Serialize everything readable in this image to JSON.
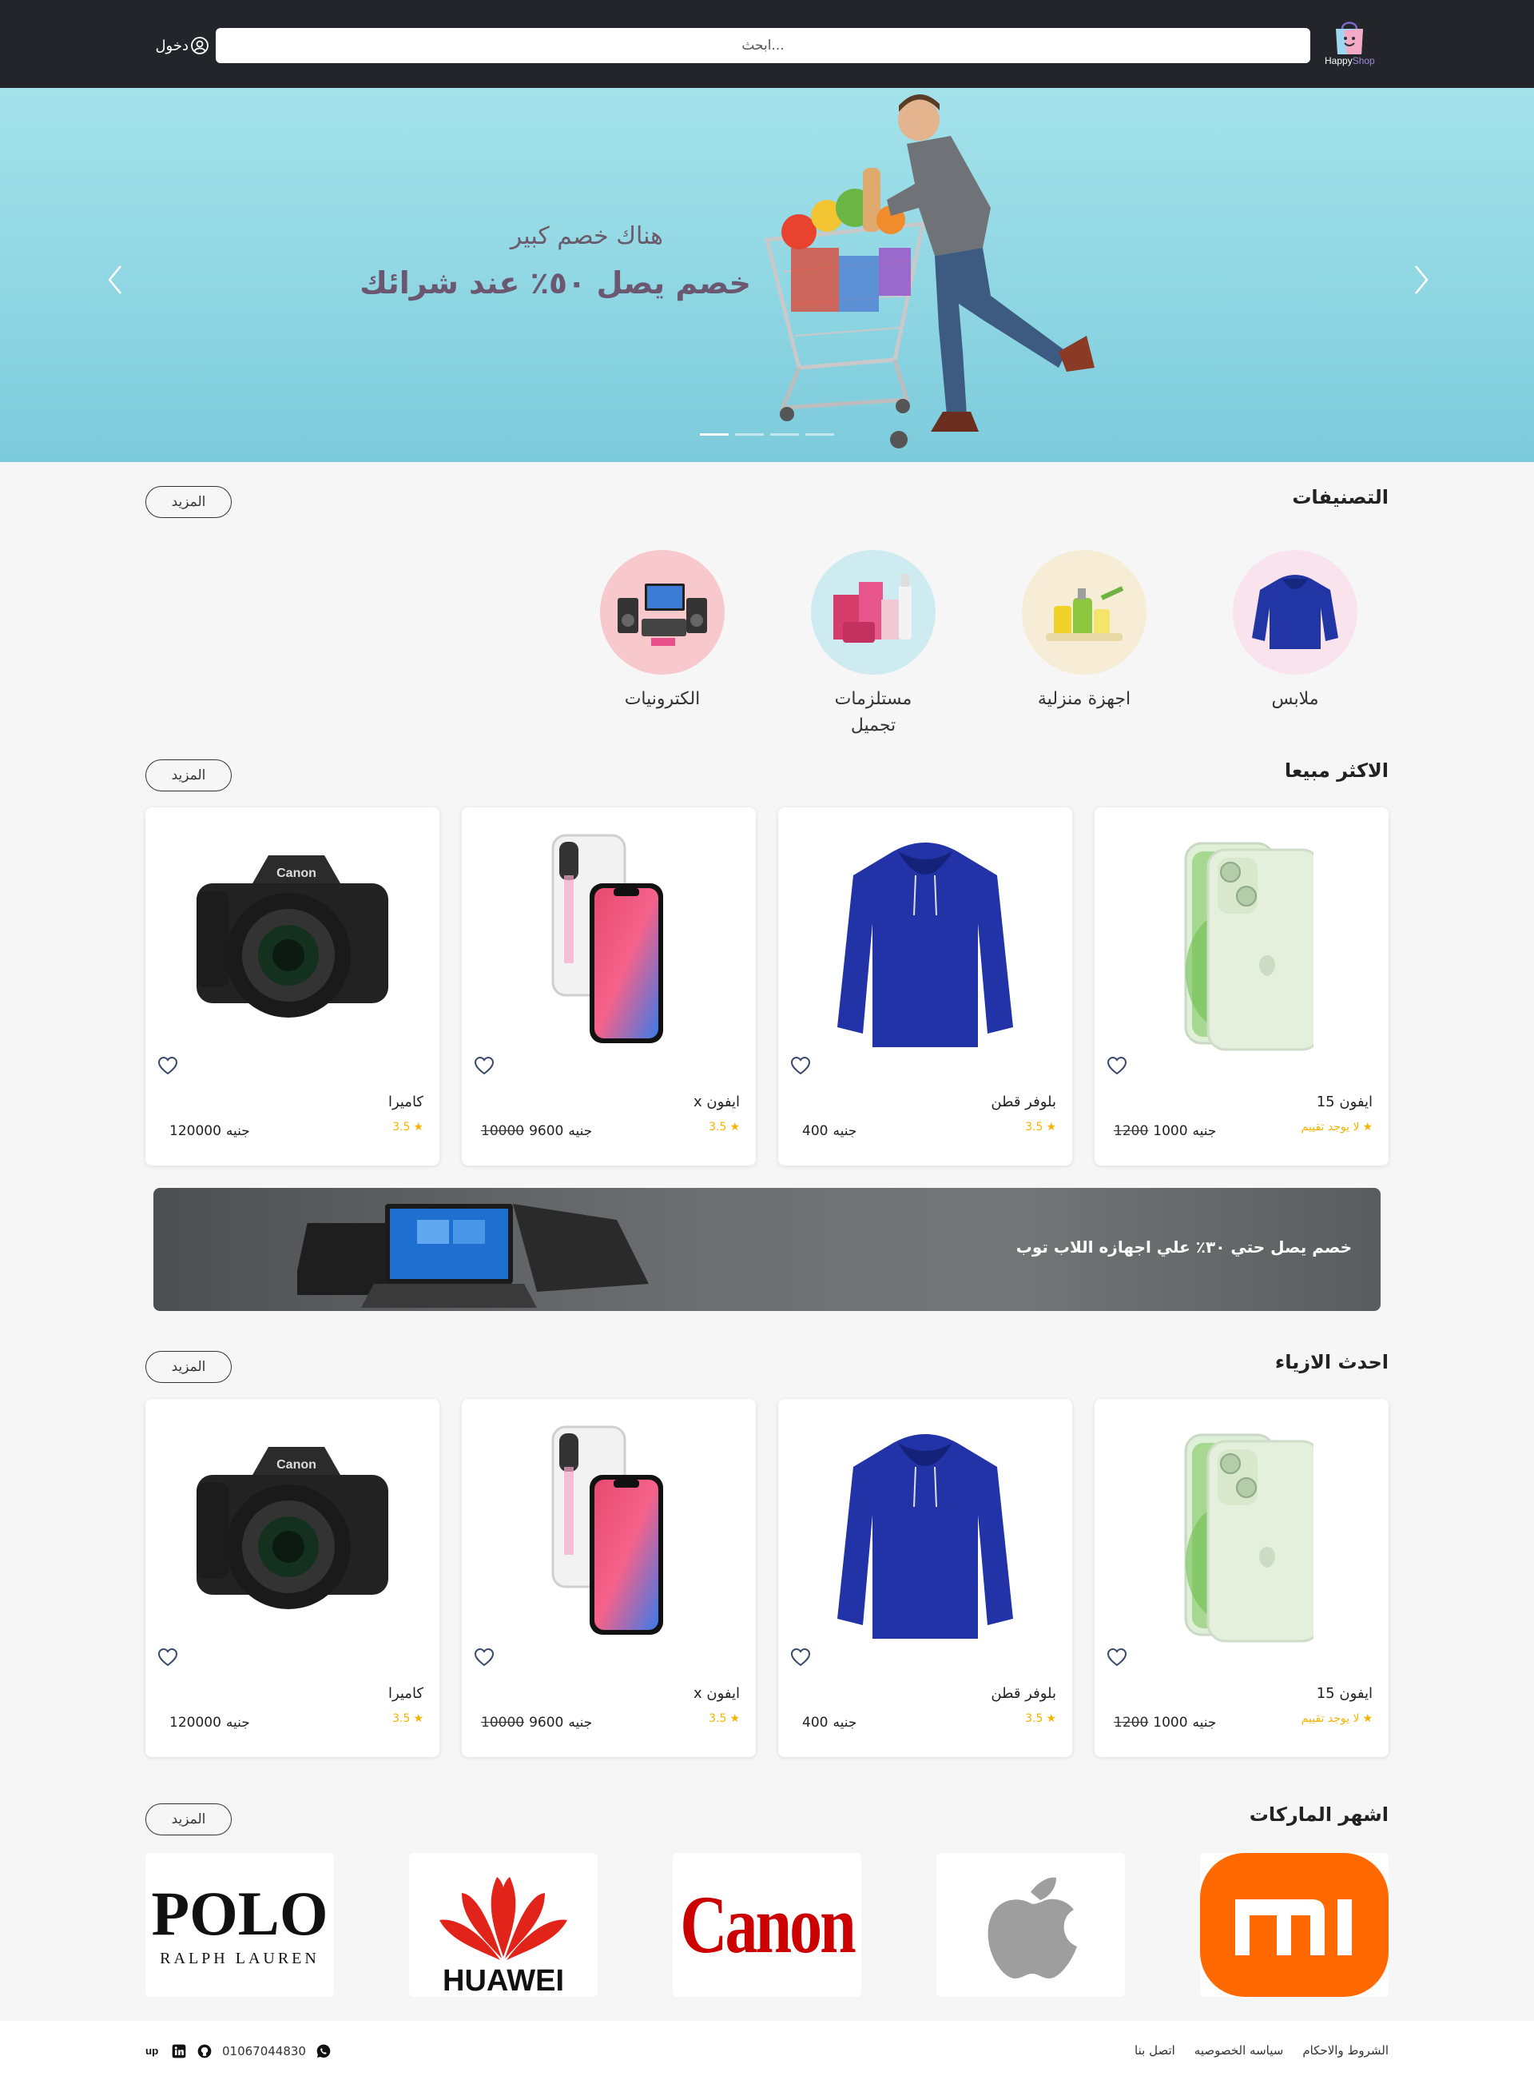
{
  "header": {
    "logo_word1": "Happy",
    "logo_word2": "Shop",
    "search_placeholder": "ابحث...",
    "login_label": "دخول"
  },
  "hero": {
    "subtitle": "هناك خصم كبير",
    "title": "خصم يصل ٥٠٪ عند شرائك",
    "slides_count": 4,
    "active_slide": 1
  },
  "categories_section": {
    "title": "التصنيفات",
    "more_label": "المزيد",
    "items": [
      {
        "label": "ملابس",
        "icon": "hoodie",
        "bg": "#f9e4ee"
      },
      {
        "label": "اجهزة منزلية",
        "icon": "cleaning-products",
        "bg": "#f7ecd6"
      },
      {
        "label": "مستلزمات تجميل",
        "icon": "cosmetics",
        "bg": "#cdebf0"
      },
      {
        "label": "الكترونيات",
        "icon": "electronics",
        "bg": "#f7c8cc"
      }
    ]
  },
  "best_sellers": {
    "title": "الاكثر مبيعا",
    "more_label": "المزيد",
    "products": [
      {
        "name": "ايفون 15",
        "rating": "لا يوجد تقييم",
        "price": "1000",
        "old_price": "1200",
        "currency": "جنيه",
        "image": "iphone-15"
      },
      {
        "name": "بلوفر قطن",
        "rating": "3.5",
        "price": "400",
        "old_price": "",
        "currency": "جنيه",
        "image": "blue-hoodie"
      },
      {
        "name": "ايفون x",
        "rating": "3.5",
        "price": "9600",
        "old_price": "10000",
        "currency": "جنيه",
        "image": "iphone-x"
      },
      {
        "name": "كاميرا",
        "rating": "3.5",
        "price": "120000",
        "old_price": "",
        "currency": "جنيه",
        "image": "canon-camera"
      }
    ]
  },
  "promo_banner": {
    "text": "خصم يصل حتي ٣٠٪ علي اجهازه اللاب توب"
  },
  "latest_fashion": {
    "title": "احدث الازياء",
    "more_label": "المزيد",
    "products": [
      {
        "name": "ايفون 15",
        "rating": "لا يوجد تقييم",
        "price": "1000",
        "old_price": "1200",
        "currency": "جنيه",
        "image": "iphone-15"
      },
      {
        "name": "بلوفر قطن",
        "rating": "3.5",
        "price": "400",
        "old_price": "",
        "currency": "جنيه",
        "image": "blue-hoodie"
      },
      {
        "name": "ايفون x",
        "rating": "3.5",
        "price": "9600",
        "old_price": "10000",
        "currency": "جنيه",
        "image": "iphone-x"
      },
      {
        "name": "كاميرا",
        "rating": "3.5",
        "price": "120000",
        "old_price": "",
        "currency": "جنيه",
        "image": "canon-camera"
      }
    ]
  },
  "brands_section": {
    "title": "اشهر الماركات",
    "more_label": "المزيد",
    "brands": [
      {
        "name": "Xiaomi",
        "mark": "mi",
        "color": "#ff6900"
      },
      {
        "name": "Apple",
        "color": "#9e9e9e"
      },
      {
        "name": "Canon",
        "mark": "Canon",
        "color": "#cc0000"
      },
      {
        "name": "Huawei",
        "mark": "HUAWEI",
        "color": "#e2231a"
      },
      {
        "name": "Polo Ralph Lauren",
        "mark": "POLO",
        "sub": "RALPH LAUREN",
        "color": "#111111"
      }
    ]
  },
  "footer": {
    "links": [
      "الشروط والاحكام",
      "سياسه الخصوصيه",
      "اتصل بنا"
    ],
    "phone": "01067044830",
    "social_icons": [
      "whatsapp-icon",
      "github-icon",
      "linkedin-icon",
      "upwork-icon"
    ]
  }
}
